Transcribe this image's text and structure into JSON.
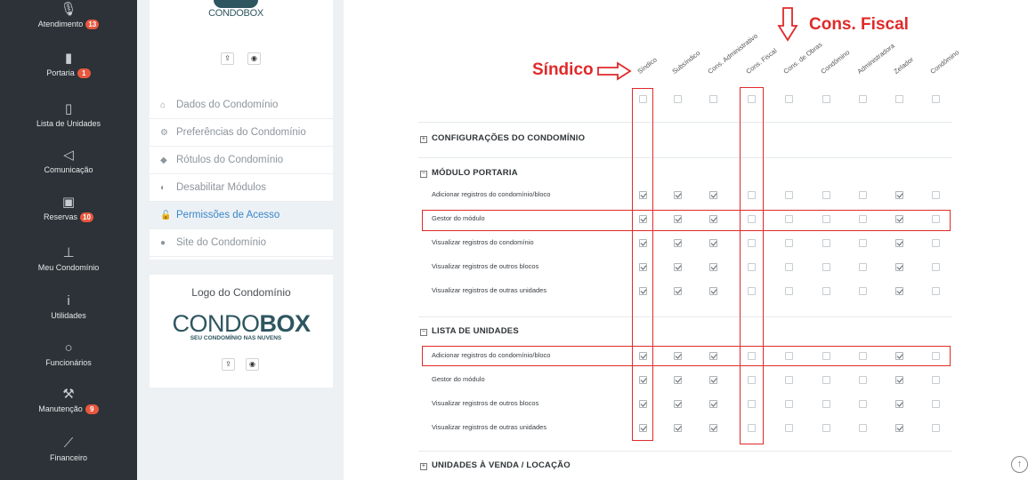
{
  "nav": {
    "items": [
      {
        "label": "Atendimento",
        "badge": "13",
        "icon": "microphone-icon",
        "glyph": "🎙"
      },
      {
        "label": "Portaria",
        "badge": "1",
        "icon": "door-icon",
        "glyph": "▮"
      },
      {
        "label": "Lista de Unidades",
        "badge": "",
        "icon": "building-icon",
        "glyph": "▯"
      },
      {
        "label": "Comunicação",
        "badge": "",
        "icon": "megaphone-icon",
        "glyph": "◁"
      },
      {
        "label": "Reservas",
        "badge": "10",
        "icon": "calendar-icon",
        "glyph": "▣"
      },
      {
        "label": "Meu Condomínio",
        "badge": "",
        "icon": "pin-icon",
        "glyph": "⊥"
      },
      {
        "label": "Utilidades",
        "badge": "",
        "icon": "info-icon",
        "glyph": "i"
      },
      {
        "label": "Funcionários",
        "badge": "",
        "icon": "circle-icon",
        "glyph": "○"
      },
      {
        "label": "Manutenção",
        "badge": "9",
        "icon": "wrench-icon",
        "glyph": "⚒"
      },
      {
        "label": "Financeiro",
        "badge": "",
        "icon": "chart-icon",
        "glyph": "⟋"
      }
    ]
  },
  "brand": {
    "logo_top": "CONDOBOX",
    "logo_big_a": "CONDO",
    "logo_big_b": "BOX",
    "logo_tagline": "SEU CONDOMÍNIO NAS NUVENS"
  },
  "settings_menu": [
    {
      "label": "Dados do Condomínio",
      "icon": "home-icon",
      "glyph": "⌂"
    },
    {
      "label": "Preferências do Condomínio",
      "icon": "gears-icon",
      "glyph": "⚙"
    },
    {
      "label": "Rótulos do Condomínio",
      "icon": "tag-icon",
      "glyph": "◆"
    },
    {
      "label": "Desabilitar Módulos",
      "icon": "toggle-icon",
      "glyph": "◐"
    },
    {
      "label": "Permissões de Acesso",
      "icon": "unlock-icon",
      "glyph": "🔓"
    },
    {
      "label": "Site do Condomínio",
      "icon": "globe-icon",
      "glyph": "●"
    }
  ],
  "logo_panel_title": "Logo do Condomínio",
  "columns": [
    "Síndico",
    "Subsíndico",
    "Cons. Administrativo",
    "Cons. Fiscal",
    "Cons. de Obras",
    "Condômino",
    "Administradora",
    "Zelador",
    "Condômino"
  ],
  "sections": [
    {
      "title": "CONFIGURAÇÕES DO CONDOMÍNIO",
      "toggle": "+"
    },
    {
      "title": "MÓDULO PORTARIA",
      "toggle": "−"
    },
    {
      "title": "LISTA DE UNIDADES",
      "toggle": "−"
    },
    {
      "title": "UNIDADES À VENDA / LOCAÇÃO",
      "toggle": "+"
    }
  ],
  "portaria_rows": [
    {
      "label": "Adicionar registros do condomínio/bloco",
      "checks": [
        1,
        1,
        1,
        0,
        0,
        0,
        0,
        1,
        0
      ]
    },
    {
      "label": "Gestor do módulo",
      "checks": [
        1,
        1,
        1,
        0,
        0,
        0,
        0,
        1,
        0
      ]
    },
    {
      "label": "Visualizar registros do condomínio",
      "checks": [
        1,
        1,
        1,
        0,
        0,
        0,
        0,
        1,
        0
      ]
    },
    {
      "label": "Visualizar registros de outros blocos",
      "checks": [
        1,
        1,
        1,
        0,
        0,
        0,
        0,
        1,
        0
      ]
    },
    {
      "label": "Visualizar registros de outras unidades",
      "checks": [
        1,
        1,
        1,
        0,
        0,
        0,
        0,
        1,
        0
      ]
    }
  ],
  "unidades_rows": [
    {
      "label": "Adicionar registros do condomínio/bloco",
      "checks": [
        1,
        1,
        1,
        0,
        0,
        0,
        0,
        1,
        0
      ]
    },
    {
      "label": "Gestor do módulo",
      "checks": [
        1,
        1,
        1,
        0,
        0,
        0,
        0,
        1,
        0
      ]
    },
    {
      "label": "Visualizar registros de outros blocos",
      "checks": [
        1,
        1,
        1,
        0,
        0,
        0,
        0,
        1,
        0
      ]
    },
    {
      "label": "Visualizar registros de outras unidades",
      "checks": [
        1,
        1,
        1,
        0,
        0,
        0,
        0,
        1,
        0
      ]
    }
  ],
  "annotations": {
    "sindico": "Síndico",
    "fiscal": "Cons. Fiscal",
    "color": "#e02a2a"
  },
  "colors": {
    "nav_bg": "#2c3237",
    "badge": "#e8573e",
    "active_link": "#3b86c9"
  }
}
